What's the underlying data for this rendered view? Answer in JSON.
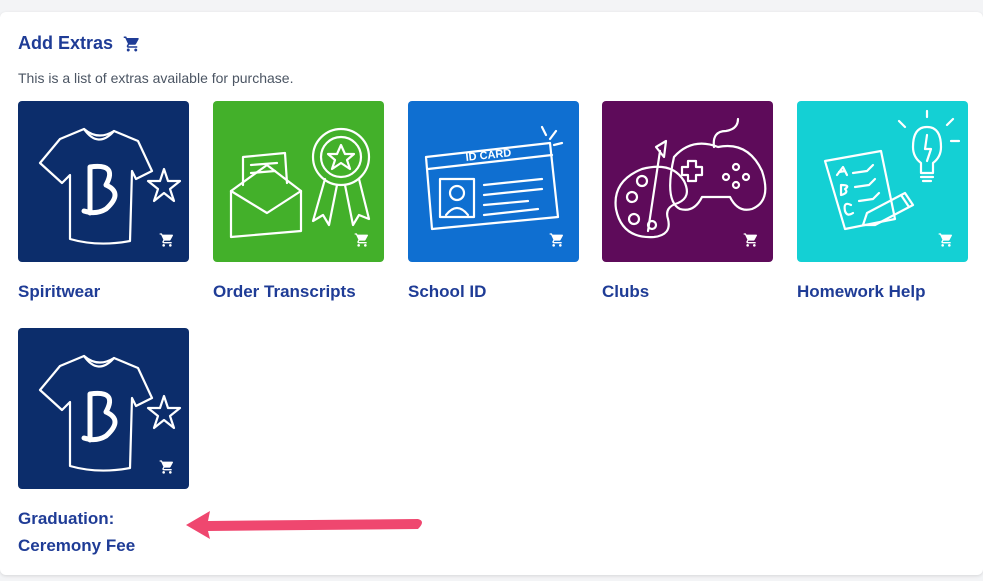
{
  "section": {
    "title": "Add Extras",
    "subtitle": "This is a list of extras available for purchase."
  },
  "extras": [
    {
      "label": "Spiritwear",
      "color": "#0c2d6b"
    },
    {
      "label": "Order Transcripts",
      "color": "#43b02a"
    },
    {
      "label": "School ID",
      "color": "#0f6fd1"
    },
    {
      "label": "Clubs",
      "color": "#5e0b5a"
    },
    {
      "label": "Homework Help",
      "color": "#14d0d4"
    },
    {
      "label_line1": "Graduation:",
      "label_line2": "Ceremony Fee",
      "color": "#0c2d6b"
    }
  ],
  "id_card_text": "ID CARD",
  "accent_colors": {
    "heading": "#1f3c96",
    "arrow": "#ef476f"
  }
}
